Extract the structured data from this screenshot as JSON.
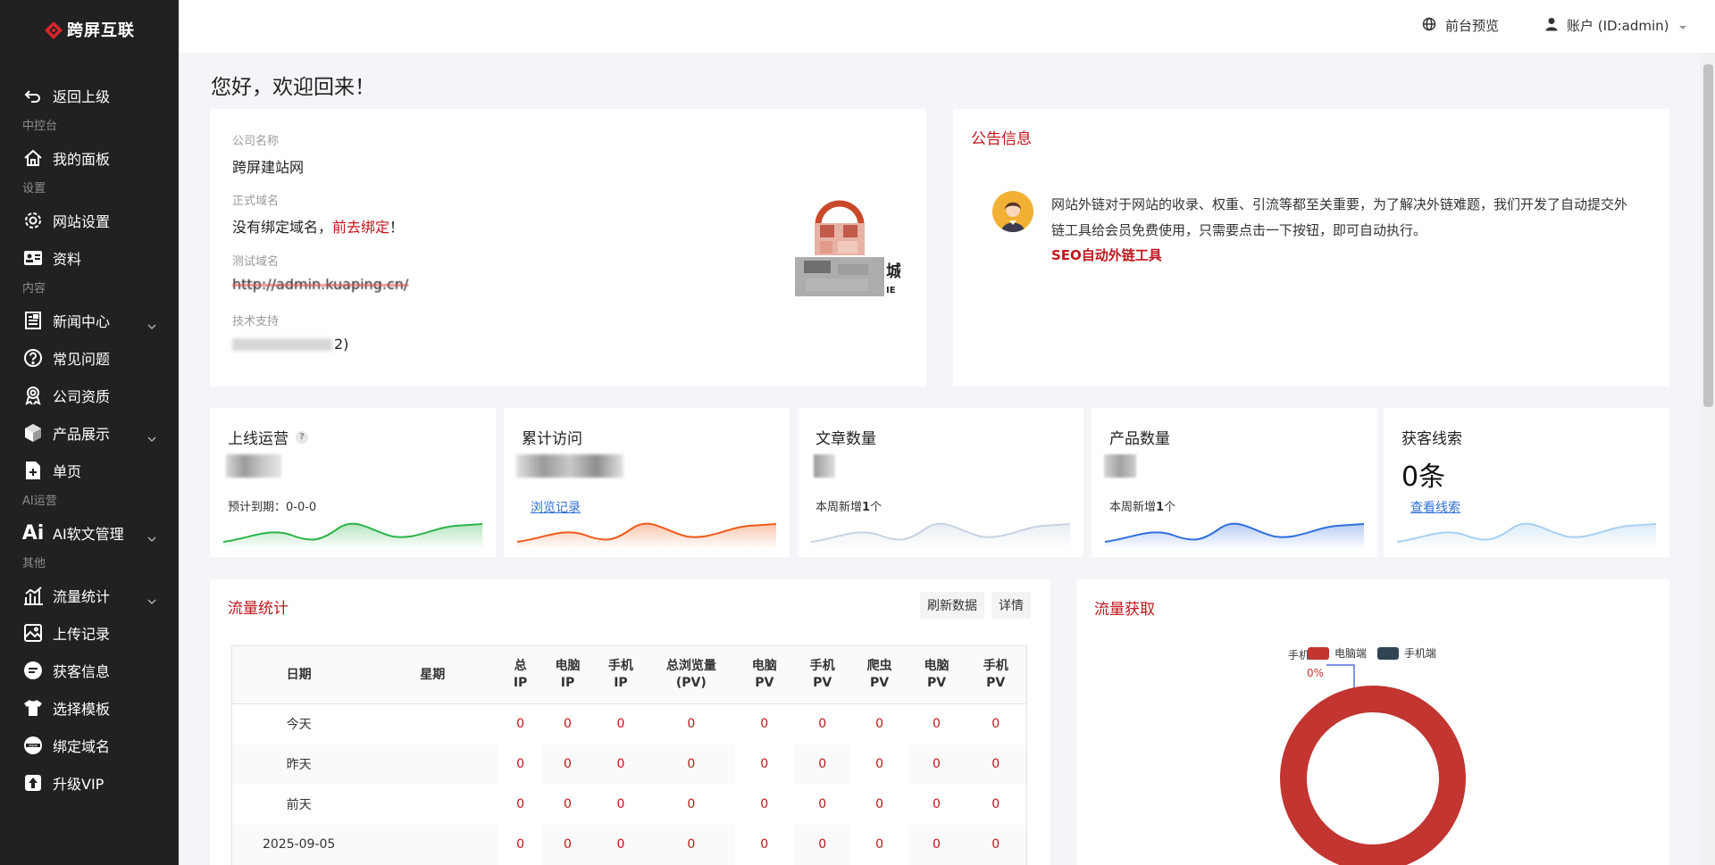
{
  "brand": {
    "name": "跨屏互联"
  },
  "sidebar": {
    "back": "返回上级",
    "groups": {
      "console": "中控台",
      "settings": "设置",
      "content": "内容",
      "ai": "AI运营",
      "other": "其他"
    },
    "items": {
      "dashboard": "我的面板",
      "site_settings": "网站设置",
      "profile": "资料",
      "news": "新闻中心",
      "faq": "常见问题",
      "qualification": "公司资质",
      "products": "产品展示",
      "single_page": "单页",
      "ai_article": "AI软文管理",
      "traffic": "流量统计",
      "uploads": "上传记录",
      "leads": "获客信息",
      "template": "选择模板",
      "bind_domain": "绑定域名",
      "vip": "升级VIP"
    }
  },
  "topbar": {
    "preview": "前台预览",
    "account": "账户 (ID:admin)"
  },
  "welcome": "您好，欢迎回来！",
  "company": {
    "name_label": "公司名称",
    "name_value": "跨屏建站网",
    "domain_label": "正式域名",
    "domain_text": "没有绑定域名，",
    "domain_link": "前去绑定",
    "domain_suffix": "！",
    "test_label": "测试域名",
    "test_value": "http://admin.kuaping.cn/",
    "support_label": "技术支持",
    "support_value": "2)"
  },
  "notice": {
    "title": "公告信息",
    "text": "网站外链对于网站的收录、权重、引流等都至关重要，为了解决外链难题，我们开发了自动提交外链工具给会员免费使用，只需要点击一下按钮，即可自动执行。",
    "link": "SEO自动外链工具"
  },
  "stats": [
    {
      "title": "上线运营",
      "sub": "预计到期：0-0-0",
      "color": "#2cb44a"
    },
    {
      "title": "累计访问",
      "link": "浏览记录",
      "color": "#f05a1a"
    },
    {
      "title": "文章数量",
      "sub_prefix": "本周新增",
      "sub_num": "1",
      "sub_suffix": "个",
      "color": "#c7d3e3"
    },
    {
      "title": "产品数量",
      "sub_prefix": "本周新增",
      "sub_num": "1",
      "sub_suffix": "个",
      "color": "#2f6fe0"
    },
    {
      "title": "获客线索",
      "big": "0条",
      "link": "查看线索",
      "color": "#a9d0f2"
    }
  ],
  "traffic": {
    "title": "流量统计",
    "refresh": "刷新数据",
    "detail": "详情",
    "headers": [
      "日期",
      "星期",
      "总\nIP",
      "电脑\nIP",
      "手机\nIP",
      "总浏览量\n(PV)",
      "电脑\nPV",
      "手机\nPV",
      "爬虫\nPV",
      "电脑\nPV",
      "手机\nPV"
    ],
    "rows": [
      {
        "date": "今天",
        "week": "",
        "values": [
          "0",
          "0",
          "0",
          "0",
          "0",
          "0",
          "0",
          "0",
          "0"
        ]
      },
      {
        "date": "昨天",
        "week": "",
        "values": [
          "0",
          "0",
          "0",
          "0",
          "0",
          "0",
          "0",
          "0",
          "0"
        ]
      },
      {
        "date": "前天",
        "week": "",
        "values": [
          "0",
          "0",
          "0",
          "0",
          "0",
          "0",
          "0",
          "0",
          "0"
        ]
      },
      {
        "date": "2025-09-05",
        "week": "",
        "values": [
          "0",
          "0",
          "0",
          "0",
          "0",
          "0",
          "0",
          "0",
          "0"
        ]
      }
    ]
  },
  "acquire": {
    "title": "流量获取",
    "legend": [
      "电脑端",
      "手机端"
    ],
    "legend_colors": [
      "#c23531",
      "#2f4554"
    ],
    "pie_label_name": "手机",
    "pie_label_pct": "0%"
  }
}
